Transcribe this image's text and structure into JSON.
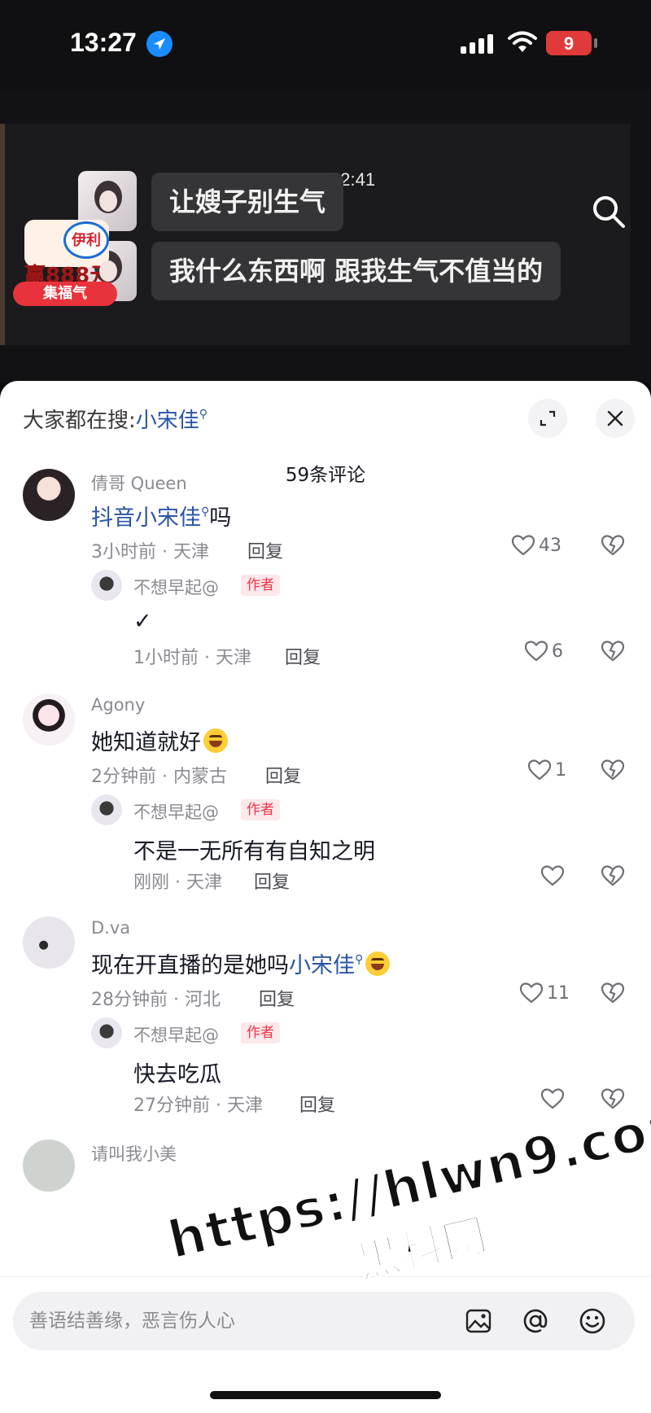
{
  "status_bar": {
    "time": "13:27",
    "battery": "9"
  },
  "video": {
    "timestamp": "12:41",
    "messages": [
      "让嫂子别生气",
      "我什么东西啊 跟我生气不值当的"
    ],
    "promo": {
      "brand": "伊利",
      "prize": "赢888元",
      "button": "集福气"
    }
  },
  "comments_panel": {
    "hot_search_prefix": "大家都在搜:",
    "hot_search_keyword": "小宋佳",
    "count_label": "59条评论",
    "reply_label": "回复",
    "author_tag": "作者",
    "comments": [
      {
        "username": "倩哥 Queen",
        "text_link": "抖音小宋佳",
        "text_after": "吗",
        "meta": "3小时前 · 天津",
        "likes": "43",
        "reply": {
          "username": "不想早起@",
          "text": "✓",
          "meta": "1小时前 · 天津",
          "likes": "6"
        }
      },
      {
        "username": "Agony",
        "text": "她知道就好",
        "meta": "2分钟前 · 内蒙古",
        "likes": "1",
        "reply": {
          "username": "不想早起@",
          "text": "不是一无所有有自知之明",
          "meta": "刚刚 · 天津",
          "likes": ""
        }
      },
      {
        "username": "D.va",
        "text_before": "现在开直播的是她吗",
        "text_link": "小宋佳",
        "meta": "28分钟前 · 河北",
        "likes": "11",
        "reply": {
          "username": "不想早起@",
          "text": "快去吃瓜",
          "meta": "27分钟前 · 天津",
          "likes": ""
        }
      },
      {
        "username": "请叫我小美"
      }
    ]
  },
  "input_bar": {
    "placeholder": "善语结善缘，恶言伤人心"
  },
  "watermark": {
    "line1": "https://hlwn9.com",
    "line2": "黑料网"
  },
  "colors": {
    "link": "#2a55a6",
    "author_tag": "#f0334a",
    "author_tag_bg": "#fde8ea",
    "location_blue": "#1a8cff",
    "battery_low": "#e03a3a"
  }
}
